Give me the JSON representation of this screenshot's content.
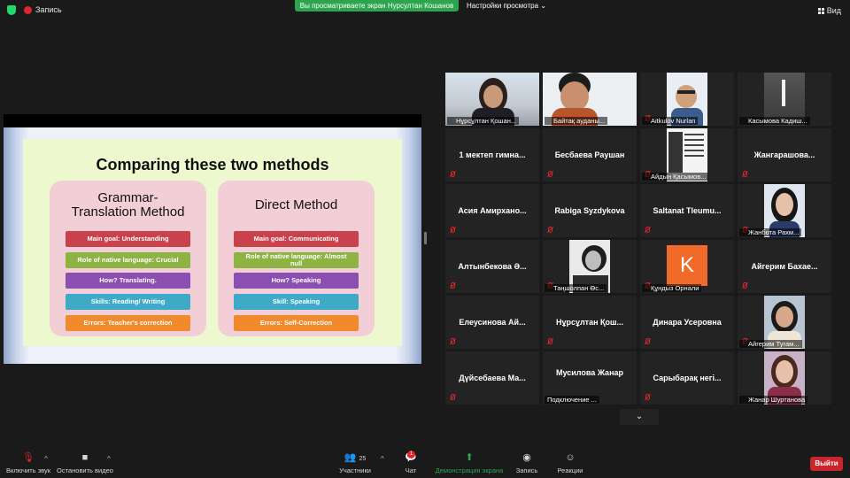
{
  "topbar": {
    "recording_label": "Запись",
    "banner_text": "Вы просматриваете экран Нурсултан Кошанов",
    "view_options_label": "Настройки просмотра",
    "view_button_label": "Вид"
  },
  "slide": {
    "title": "Comparing these two methods",
    "left": {
      "title_line1": "Grammar-",
      "title_line2": "Translation Method",
      "items": [
        "Main goal: Understanding",
        "Role of native language: Crucial",
        "How? Translating.",
        "Skills: Reading/ Writing",
        "Errors: Teacher's correction"
      ]
    },
    "right": {
      "title": "Direct Method",
      "items": [
        "Main goal: Communicating",
        "Role of native language: Almost",
        "null",
        "How? Speaking",
        "Skill: Speaking",
        "Errors: Self-Correction"
      ]
    },
    "pill_colors": [
      "#c9414b",
      "#8db343",
      "#8a4fb0",
      "#3eaac8",
      "#f08a2c"
    ]
  },
  "participants": [
    {
      "label": "Нұрсұлтан Қошан..."
    },
    {
      "label": "Байтақ ауданы..."
    },
    {
      "label": "Aitkulov Nurlan"
    },
    {
      "label": "Касымова Кадиш..."
    },
    {
      "name": "1 мектеп гимна..."
    },
    {
      "name": "Бесбаева Раушан"
    },
    {
      "label": "Айдын Қасымов..."
    },
    {
      "name": "Жангарашова..."
    },
    {
      "name": "Асия Амирхано..."
    },
    {
      "name": "Rabiga Syzdykova"
    },
    {
      "name": "Saltanat Tleumu..."
    },
    {
      "label": "Жанбота Рахм..."
    },
    {
      "name": "Алтынбекова Ә..."
    },
    {
      "label": "Таңшолпан Өс..."
    },
    {
      "label": "Құндыз Орнали",
      "avatar_letter": "K"
    },
    {
      "name": "Айгерим Бахае..."
    },
    {
      "name": "Елеусинова Ай..."
    },
    {
      "name": "Нұрсұлтан Қош..."
    },
    {
      "name": "Динара Усеровна"
    },
    {
      "label": "Айгерим Тугам..."
    },
    {
      "name": "Дүйсебаева Ма..."
    },
    {
      "name": "Мусилова Жанар",
      "status": "Подключение ..."
    },
    {
      "name": "Сарыбарақ негі..."
    },
    {
      "label": "Жанар Шуртанова"
    }
  ],
  "toolbar": {
    "unmute": "Включить звук",
    "stop_video": "Остановить видео",
    "participants": "Участники",
    "participants_count": "25",
    "chat": "Чат",
    "chat_badge": "1",
    "share": "Демонстрация экрана",
    "record": "Запись",
    "reactions": "Реакции",
    "leave": "Выйти"
  }
}
